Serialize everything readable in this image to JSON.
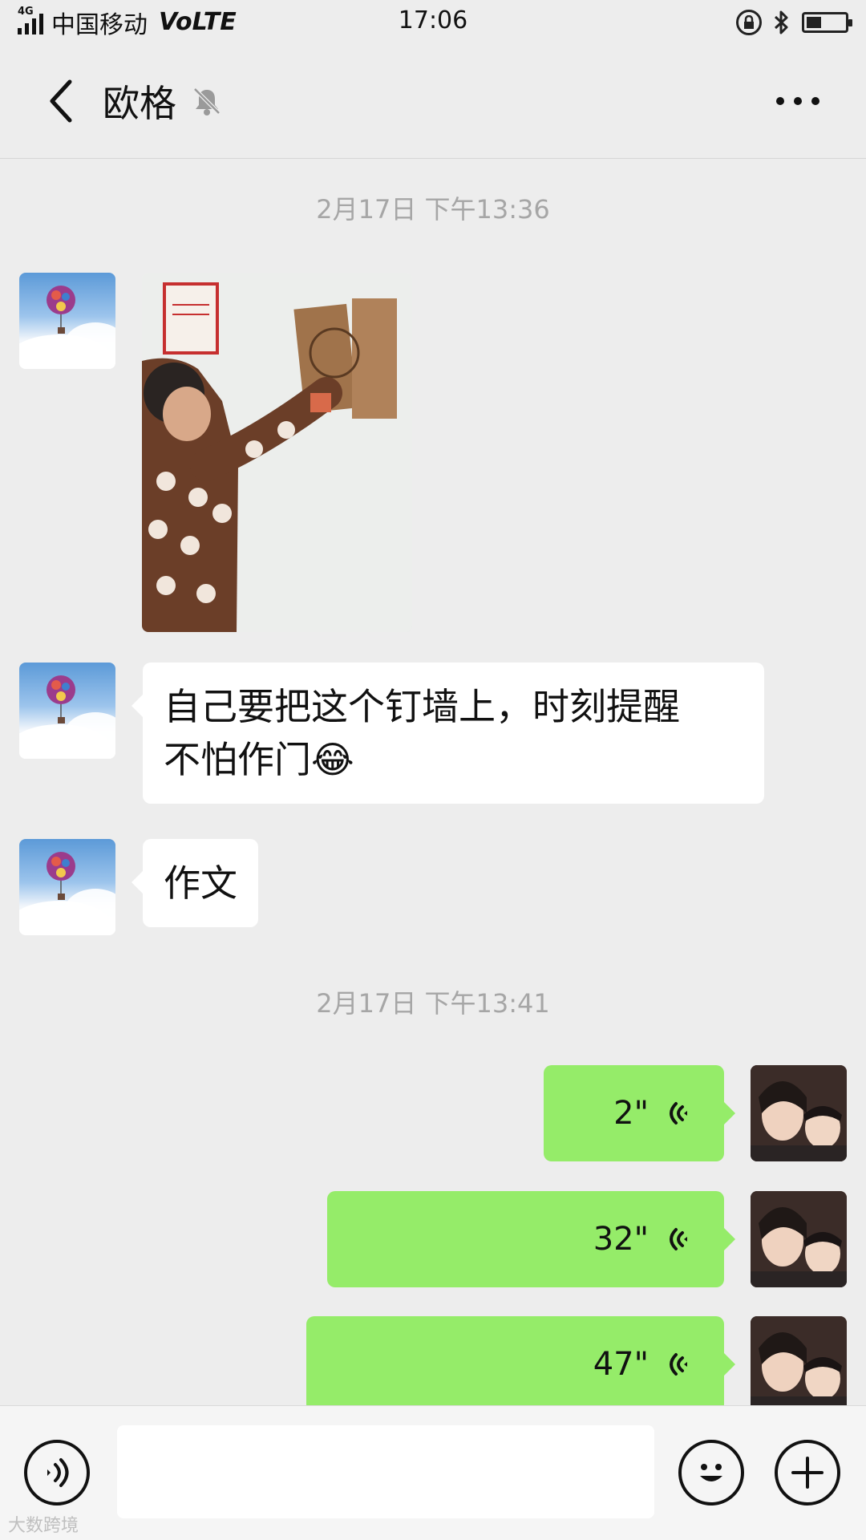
{
  "status_bar": {
    "network": "4G",
    "carrier": "中国移动",
    "volte": "VoLTE",
    "time": "17:06",
    "battery_level": 0.4
  },
  "header": {
    "title": "欧格",
    "muted": true
  },
  "timestamps": [
    "2月17日 下午13:36",
    "2月17日 下午13:41"
  ],
  "messages": [
    {
      "direction": "in",
      "type": "image",
      "description": "photo"
    },
    {
      "direction": "in",
      "type": "text",
      "lines": [
        "自己要把这个钉墙上，时刻提醒",
        "不怕作门😂"
      ]
    },
    {
      "direction": "in",
      "type": "text",
      "lines": [
        "作文"
      ]
    },
    {
      "direction": "out",
      "type": "voice",
      "duration": "2\""
    },
    {
      "direction": "out",
      "type": "voice",
      "duration": "32\""
    },
    {
      "direction": "out",
      "type": "voice",
      "duration": "47\""
    }
  ],
  "input": {
    "value": ""
  },
  "watermark": "大数跨境",
  "colors": {
    "background": "#ededed",
    "outgoing_bubble": "#95ec69",
    "incoming_bubble": "#ffffff",
    "timestamp": "#a6a6a6"
  }
}
